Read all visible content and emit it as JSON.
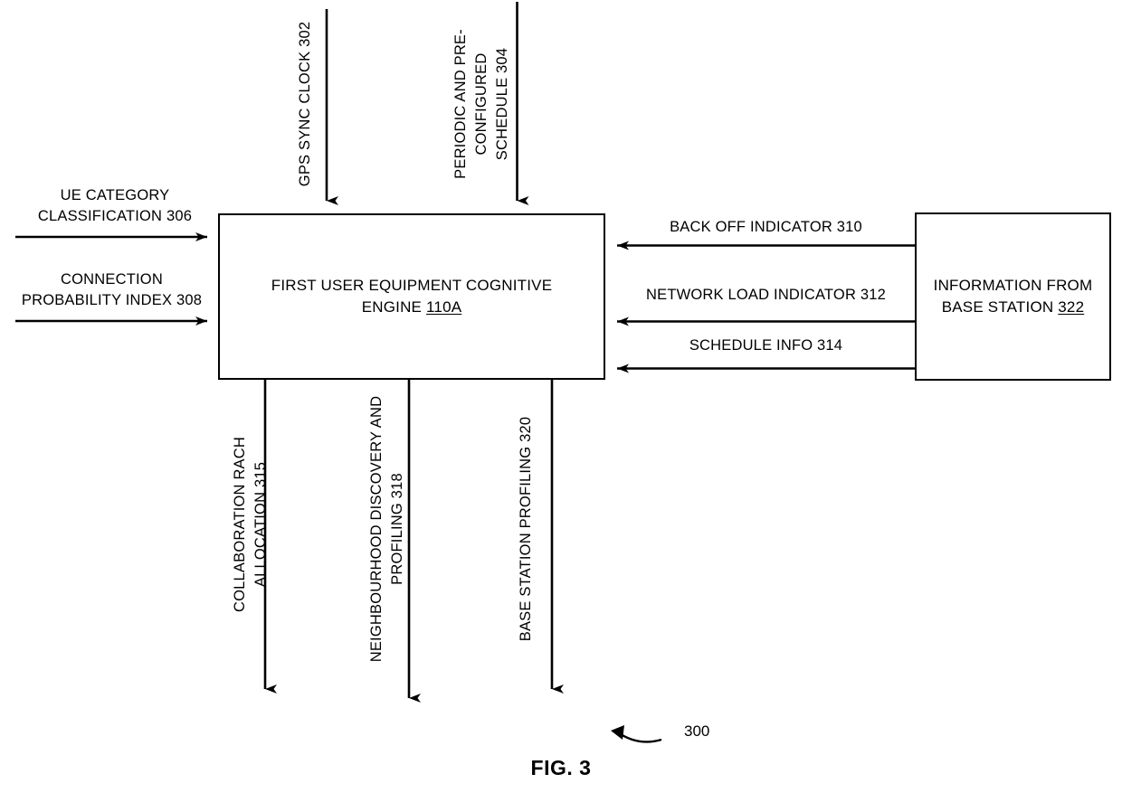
{
  "figure": {
    "caption": "FIG. 3",
    "reference_numeral": "300"
  },
  "boxes": {
    "cognitive_engine": {
      "label": "FIRST USER EQUIPMENT COGNITIVE ENGINE ",
      "label_line1": "FIRST USER EQUIPMENT COGNITIVE",
      "label_line2": "ENGINE ",
      "numeral": "110A"
    },
    "base_station_info": {
      "label_line1": "INFORMATION FROM",
      "label_line2": "BASE STATION ",
      "numeral": "322"
    }
  },
  "inputs_top": [
    {
      "label": "GPS SYNC CLOCK 302"
    },
    {
      "label": "PERIODIC AND PRE-\nCONFIGURED\nSCHEDULE 304"
    }
  ],
  "inputs_left": [
    {
      "label": "UE CATEGORY\nCLASSIFICATION 306"
    },
    {
      "label": "CONNECTION\nPROBABILITY INDEX 308"
    }
  ],
  "inputs_right": [
    {
      "label": "BACK OFF INDICATOR 310"
    },
    {
      "label": "NETWORK LOAD INDICATOR 312"
    },
    {
      "label": "SCHEDULE INFO 314"
    }
  ],
  "outputs_bottom": [
    {
      "label": "COLLABORATION RACH\nALLOCATION 315"
    },
    {
      "label": "NEIGHBOURHOOD DISCOVERY AND\nPROFILING 318"
    },
    {
      "label": "BASE STATION PROFILING 320"
    }
  ],
  "colors": {
    "stroke": "#000000",
    "background": "#ffffff"
  }
}
